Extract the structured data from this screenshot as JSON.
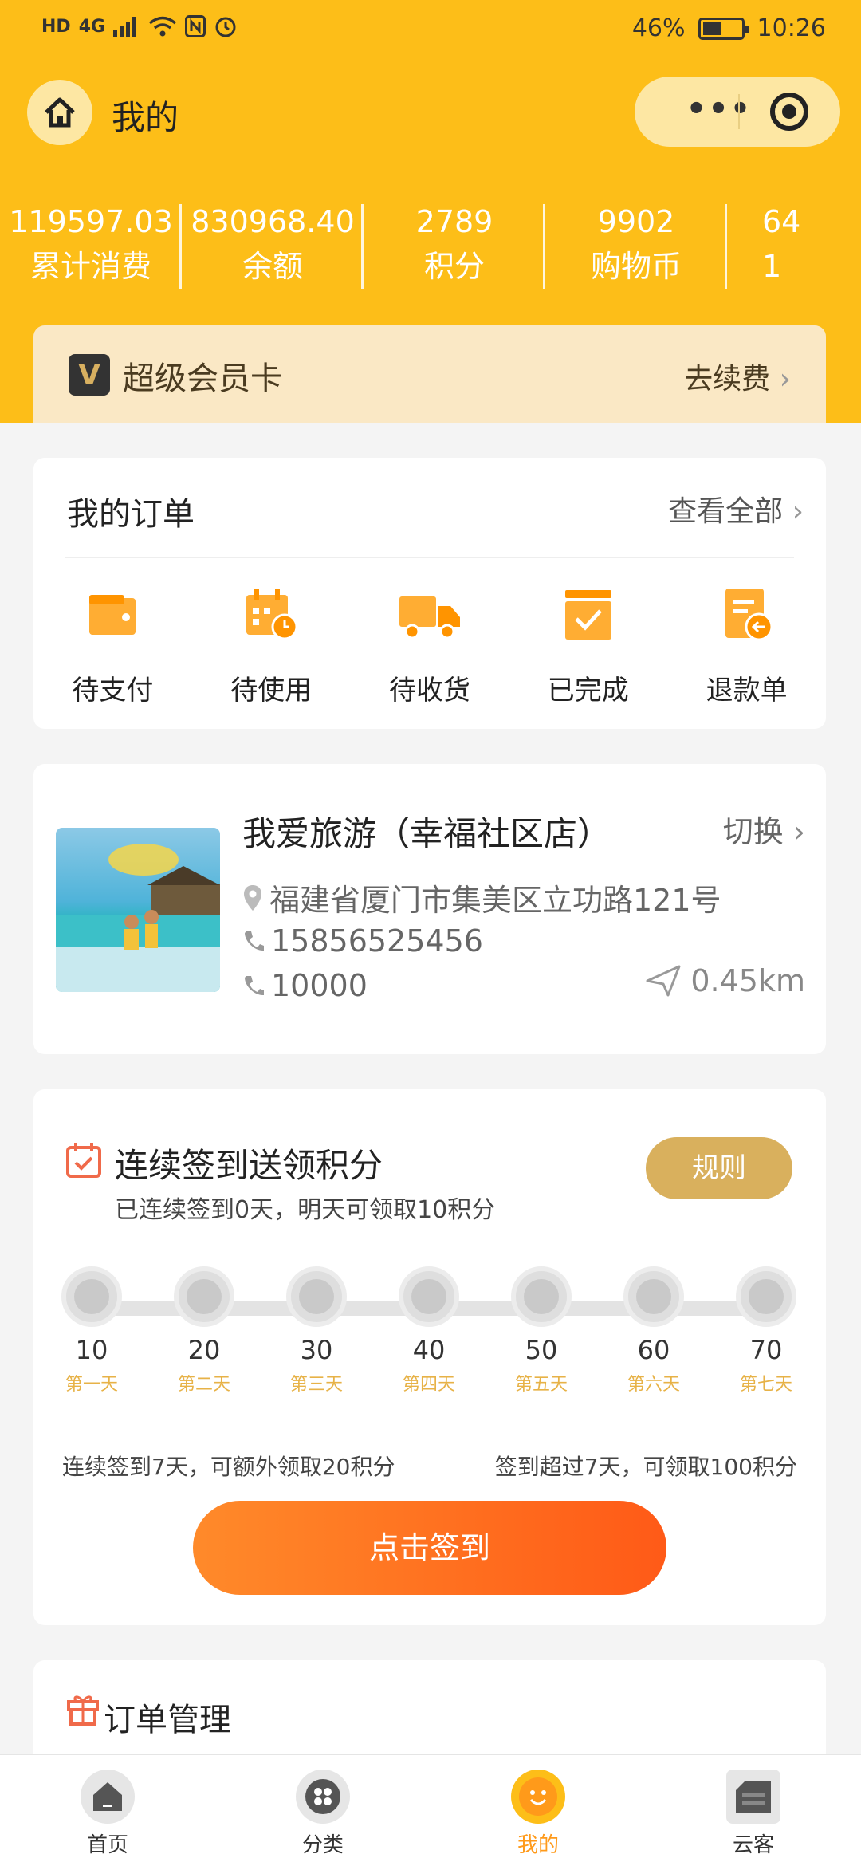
{
  "status_bar": {
    "left_labels": [
      "HD",
      "4G"
    ],
    "battery": "46%",
    "time": "10:26"
  },
  "nav": {
    "title": "我的",
    "capsule_dots": "•••"
  },
  "stats": [
    {
      "value": "119597.03",
      "label": "累计消费"
    },
    {
      "value": "830968.40",
      "label": "余额"
    },
    {
      "value": "2789",
      "label": "积分"
    },
    {
      "value": "9902",
      "label": "购物币"
    },
    {
      "value": "64",
      "label": "1"
    }
  ],
  "vip": {
    "logo": "V",
    "title": "超级会员卡",
    "action": "去续费"
  },
  "orders": {
    "title": "我的订单",
    "more": "查看全部",
    "items": [
      {
        "label": "待支付",
        "icon": "wallet-icon"
      },
      {
        "label": "待使用",
        "icon": "calendar-clock-icon"
      },
      {
        "label": "待收货",
        "icon": "truck-icon"
      },
      {
        "label": "已完成",
        "icon": "completed-icon"
      },
      {
        "label": "退款单",
        "icon": "refund-icon"
      }
    ]
  },
  "store": {
    "name": "我爱旅游（幸福社区店）",
    "switch": "切换",
    "address": "福建省厦门市集美区立功路121号",
    "phone1": "15856525456",
    "phone2": "10000",
    "distance": "0.45km"
  },
  "signin": {
    "title": "连续签到送领积分",
    "subtitle": "已连续签到0天，明天可领取10积分",
    "rule": "规则",
    "days": [
      {
        "points": "10",
        "day": "第一天"
      },
      {
        "points": "20",
        "day": "第二天"
      },
      {
        "points": "30",
        "day": "第三天"
      },
      {
        "points": "40",
        "day": "第四天"
      },
      {
        "points": "50",
        "day": "第五天"
      },
      {
        "points": "60",
        "day": "第六天"
      },
      {
        "points": "70",
        "day": "第七天"
      }
    ],
    "note_left": "连续签到7天，可额外领取20积分",
    "note_right": "签到超过7天，可领取100积分",
    "button": "点击签到"
  },
  "manage": {
    "title": "订单管理"
  },
  "tabs": [
    {
      "label": "首页",
      "icon": "home-icon"
    },
    {
      "label": "分类",
      "icon": "category-icon"
    },
    {
      "label": "我的",
      "icon": "smile-icon"
    },
    {
      "label": "云客",
      "icon": "cloud-shop-icon"
    }
  ],
  "colors": {
    "brand": "#fdbe18",
    "accent": "#ff6a1f",
    "gold": "#d9b05d"
  }
}
